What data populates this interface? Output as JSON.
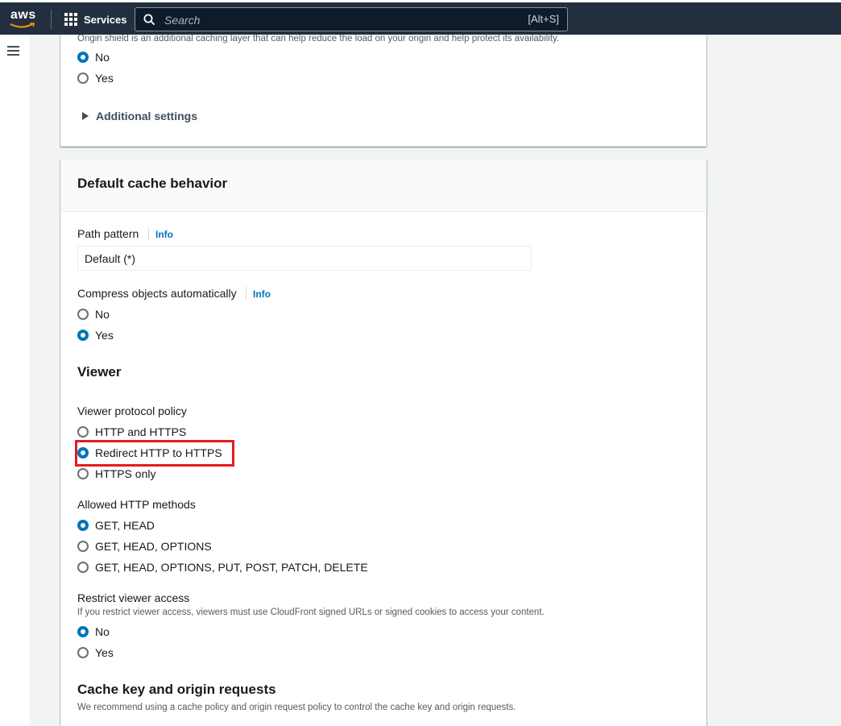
{
  "topnav": {
    "logo_text": "aws",
    "services_label": "Services",
    "search_placeholder": "Search",
    "search_shortcut": "[Alt+S]"
  },
  "origin_shield": {
    "description": "Origin shield is an additional caching layer that can help reduce the load on your origin and help protect its availability.",
    "options": [
      {
        "label": "No",
        "selected": true
      },
      {
        "label": "Yes",
        "selected": false
      }
    ],
    "additional_settings_label": "Additional settings"
  },
  "default_cache_behavior": {
    "title": "Default cache behavior",
    "path_pattern": {
      "label": "Path pattern",
      "info": "Info",
      "value": "Default (*)"
    },
    "compress": {
      "label": "Compress objects automatically",
      "info": "Info",
      "options": [
        {
          "label": "No",
          "selected": false
        },
        {
          "label": "Yes",
          "selected": true
        }
      ]
    },
    "viewer": {
      "heading": "Viewer",
      "protocol_policy": {
        "label": "Viewer protocol policy",
        "options": [
          {
            "label": "HTTP and HTTPS",
            "selected": false
          },
          {
            "label": "Redirect HTTP to HTTPS",
            "selected": true
          },
          {
            "label": "HTTPS only",
            "selected": false
          }
        ]
      },
      "allowed_methods": {
        "label": "Allowed HTTP methods",
        "options": [
          {
            "label": "GET, HEAD",
            "selected": true
          },
          {
            "label": "GET, HEAD, OPTIONS",
            "selected": false
          },
          {
            "label": "GET, HEAD, OPTIONS, PUT, POST, PATCH, DELETE",
            "selected": false
          }
        ]
      },
      "restrict_access": {
        "label": "Restrict viewer access",
        "description": "If you restrict viewer access, viewers must use CloudFront signed URLs or signed cookies to access your content.",
        "options": [
          {
            "label": "No",
            "selected": true
          },
          {
            "label": "Yes",
            "selected": false
          }
        ]
      }
    },
    "cache_key": {
      "heading": "Cache key and origin requests",
      "description": "We recommend using a cache policy and origin request policy to control the cache key and origin requests."
    }
  },
  "colors": {
    "nav_bg": "#232f3e",
    "accent": "#0073bb",
    "highlight": "#e31b23"
  }
}
